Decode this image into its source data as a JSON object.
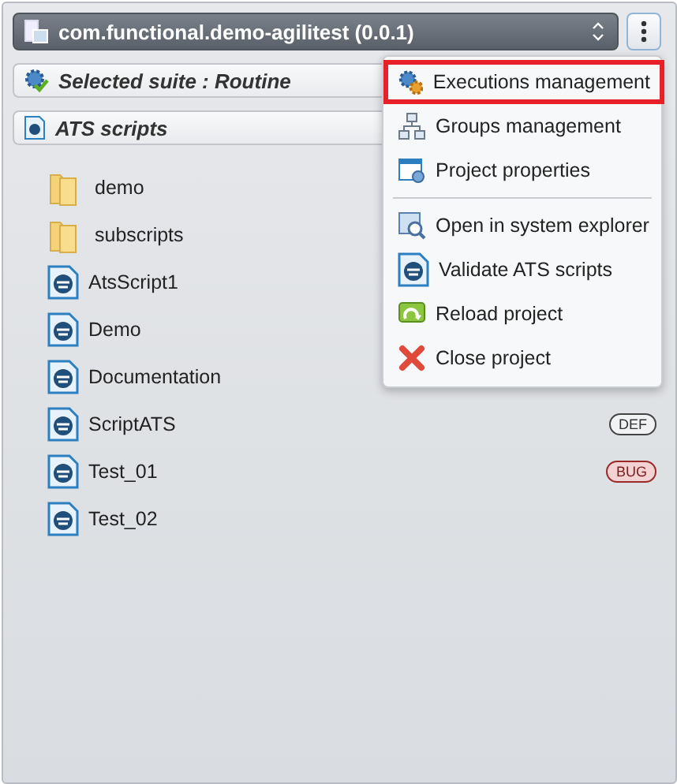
{
  "project": {
    "title": "com.functional.demo-agilitest (0.0.1)"
  },
  "suite": {
    "label": "Selected suite : Routine"
  },
  "section": {
    "title": "ATS scripts"
  },
  "tree": [
    {
      "kind": "folder",
      "name": "demo"
    },
    {
      "kind": "folder",
      "name": "subscripts"
    },
    {
      "kind": "script",
      "name": "AtsScript1"
    },
    {
      "kind": "script",
      "name": "Demo"
    },
    {
      "kind": "script",
      "name": "Documentation"
    },
    {
      "kind": "script",
      "name": "ScriptATS",
      "tag": {
        "kind": "def",
        "text": "DEF"
      }
    },
    {
      "kind": "script",
      "name": "Test_01",
      "tag": {
        "kind": "bug",
        "text": "BUG"
      }
    },
    {
      "kind": "script",
      "name": "Test_02"
    }
  ],
  "menu": {
    "groups": [
      [
        {
          "kind": "gears",
          "label": "Executions management",
          "highlighted": true
        },
        {
          "kind": "network",
          "label": "Groups management",
          "highlighted": false
        },
        {
          "kind": "properties",
          "label": "Project properties",
          "highlighted": false
        }
      ],
      [
        {
          "kind": "explorer",
          "label": "Open in system explorer",
          "highlighted": false
        },
        {
          "kind": "script",
          "label": "Validate ATS scripts",
          "highlighted": false
        },
        {
          "kind": "reload",
          "label": "Reload project",
          "highlighted": false
        },
        {
          "kind": "close",
          "label": "Close project",
          "highlighted": false
        }
      ]
    ]
  }
}
